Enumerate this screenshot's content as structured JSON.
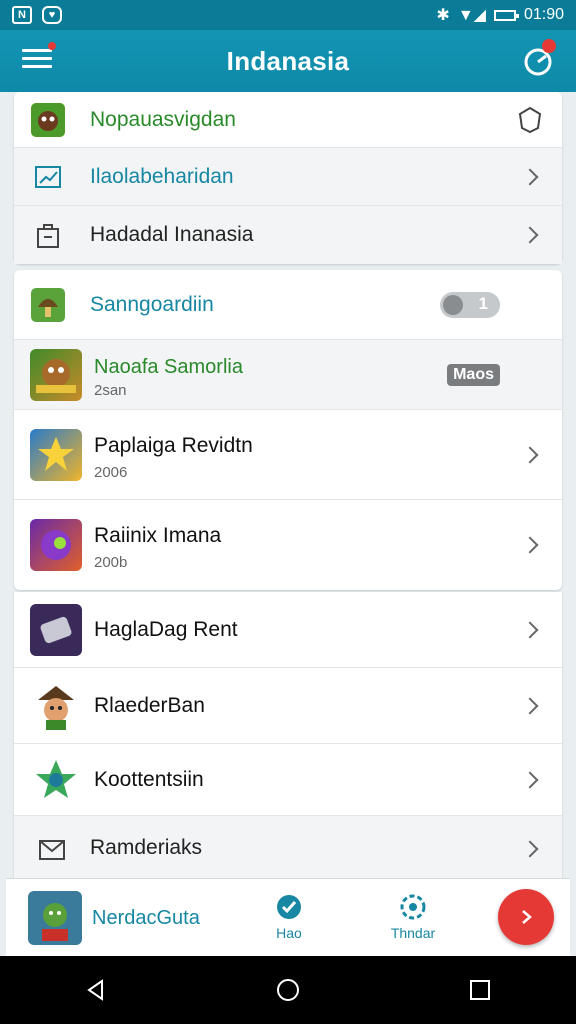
{
  "status_bar": {
    "time": "01:90"
  },
  "app_bar": {
    "title": "Indanasia"
  },
  "rows": [
    {
      "label": "Nopauasvigdan"
    },
    {
      "label": "Ilaolabeharidan"
    },
    {
      "label": "Hadadal Inanasia"
    }
  ],
  "section": {
    "header": {
      "label": "Sanngoardiin",
      "toggle_value": "1"
    },
    "featured": {
      "title": "Naoafa Samorlia",
      "sub": "2san",
      "badge": "Maos"
    },
    "items": [
      {
        "title": "Paplaiga Revidtn",
        "sub": "2006"
      },
      {
        "title": "Raiinix Imana",
        "sub": "200b"
      }
    ]
  },
  "list": [
    {
      "title": "HaglaDag Rent"
    },
    {
      "title": "RlaederBan"
    },
    {
      "title": "Koottentsiin"
    },
    {
      "title": "Ramderiaks"
    }
  ],
  "bottom_bar": {
    "label": "NerdacGuta",
    "tab1": "Hao",
    "tab2": "Thndar"
  },
  "colors": {
    "accent": "#1395b4",
    "fab": "#e53935"
  }
}
